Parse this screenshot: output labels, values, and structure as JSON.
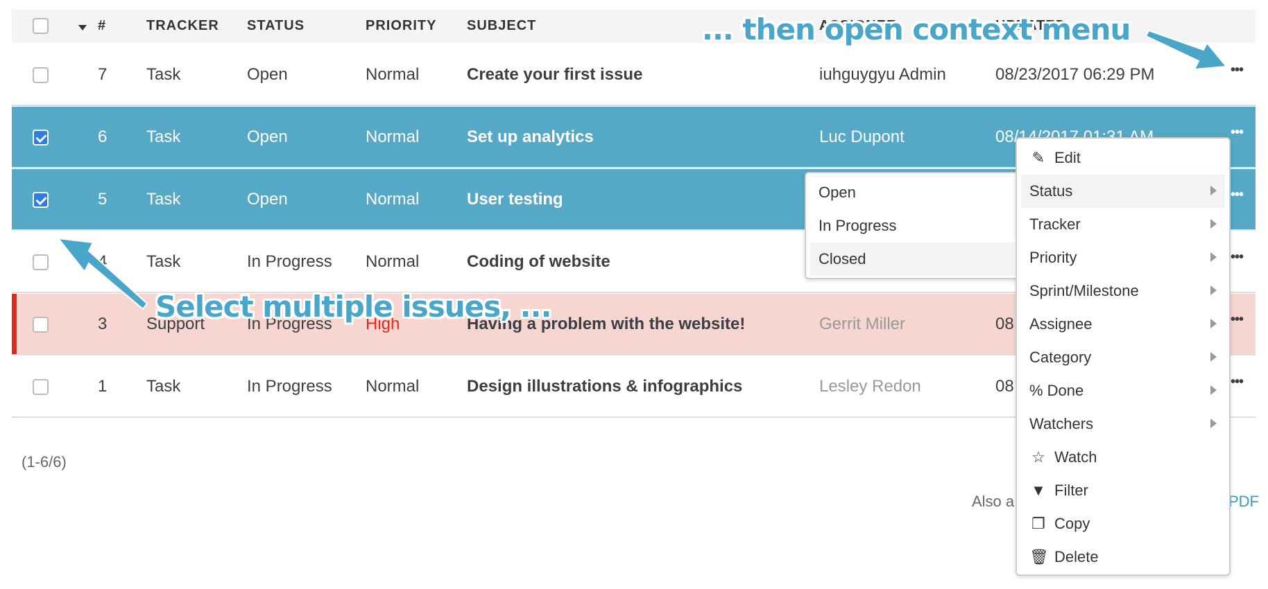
{
  "table": {
    "headers": {
      "number": "#",
      "tracker": "TRACKER",
      "status": "STATUS",
      "priority": "PRIORITY",
      "subject": "SUBJECT",
      "assignee": "ASSIGNEE",
      "updated": "UPDATED"
    },
    "rows": [
      {
        "id": "7",
        "tracker": "Task",
        "status": "Open",
        "priority": "Normal",
        "subject": "Create your first issue",
        "assignee": "iuhguygyu Admin",
        "updated": "08/23/2017 06:29 PM",
        "checked": false
      },
      {
        "id": "6",
        "tracker": "Task",
        "status": "Open",
        "priority": "Normal",
        "subject": "Set up analytics",
        "assignee": "Luc Dupont",
        "updated": "08/14/2017 01:31 AM",
        "checked": true
      },
      {
        "id": "5",
        "tracker": "Task",
        "status": "Open",
        "priority": "Normal",
        "subject": "User testing",
        "assignee": "",
        "updated": "",
        "checked": true
      },
      {
        "id": "4",
        "tracker": "Task",
        "status": "In Progress",
        "priority": "Normal",
        "subject": "Coding of website",
        "assignee": "",
        "updated": "",
        "checked": false
      },
      {
        "id": "3",
        "tracker": "Support",
        "status": "In Progress",
        "priority": "High",
        "subject": "Having a problem with the website!",
        "assignee": "Gerrit Miller",
        "updated": "08",
        "checked": false
      },
      {
        "id": "1",
        "tracker": "Task",
        "status": "In Progress",
        "priority": "Normal",
        "subject": "Design illustrations & infographics",
        "assignee": "Lesley Redon",
        "updated": "08",
        "checked": false
      }
    ],
    "row_menu_icon": "ellipsis-icon"
  },
  "footer": {
    "count": "(1-6/6)",
    "also": "Also a",
    "pdf": "PDF"
  },
  "context_menu": {
    "items": [
      {
        "label": "Edit",
        "icon": "edit-icon"
      },
      {
        "label": "Status",
        "submenu": true
      },
      {
        "label": "Tracker",
        "submenu": true
      },
      {
        "label": "Priority",
        "submenu": true
      },
      {
        "label": "Sprint/Milestone",
        "submenu": true
      },
      {
        "label": "Assignee",
        "submenu": true
      },
      {
        "label": "Category",
        "submenu": true
      },
      {
        "label": "% Done",
        "submenu": true
      },
      {
        "label": "Watchers",
        "submenu": true
      },
      {
        "label": "Watch",
        "icon": "star-icon"
      },
      {
        "label": "Filter",
        "icon": "filter-icon"
      },
      {
        "label": "Copy",
        "icon": "copy-icon"
      },
      {
        "label": "Delete",
        "icon": "trash-icon"
      }
    ]
  },
  "status_submenu": {
    "items": [
      "Open",
      "In Progress",
      "Closed"
    ]
  },
  "annotations": {
    "top": "... then open context menu",
    "bottom": "Select multiple issues, ..."
  },
  "colors": {
    "selected_row": "#55a8c6",
    "high_priority_row": "#f7d5d0",
    "high_priority": "#e02b1c",
    "annotation": "#4aa6c8"
  }
}
